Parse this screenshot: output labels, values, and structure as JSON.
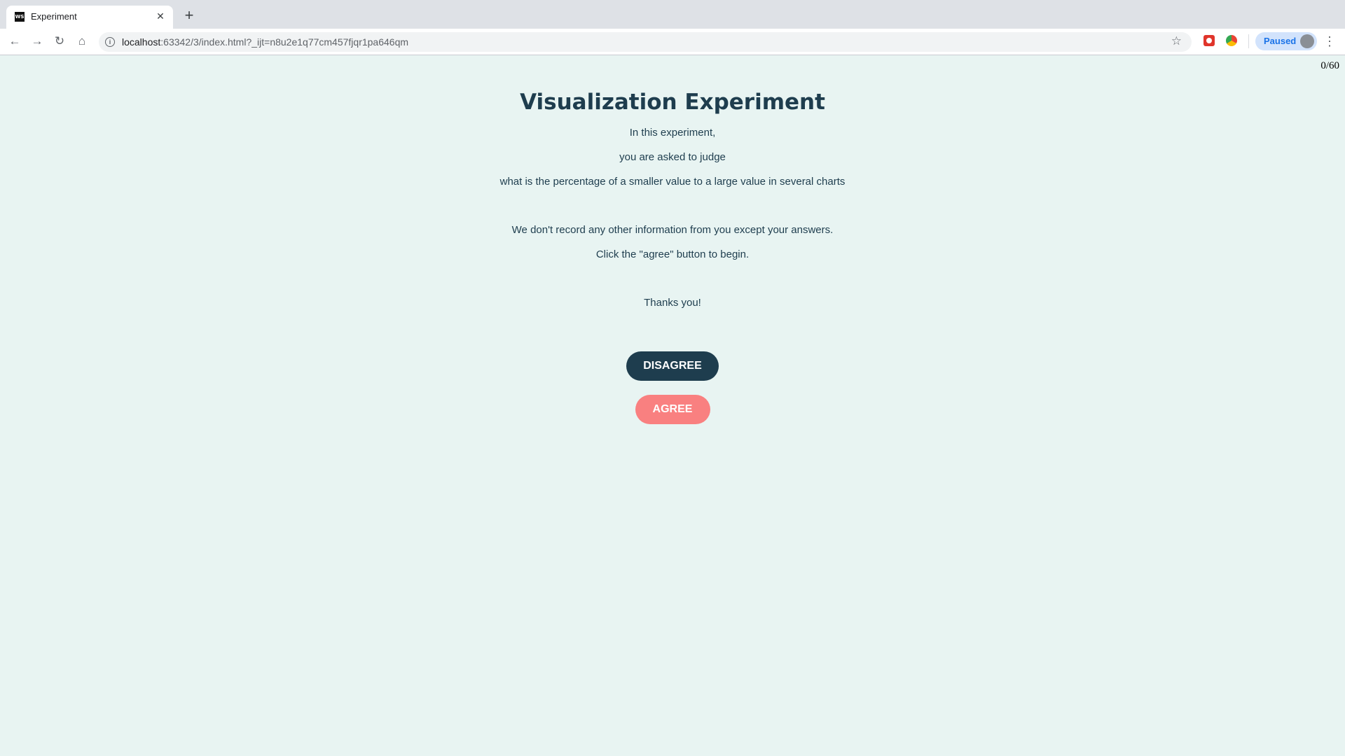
{
  "browser": {
    "tab_title": "Experiment",
    "tab_favicon_text": "WS",
    "url_host": "localhost",
    "url_rest": ":63342/3/index.html?_ijt=n8u2e1q77cm457fjqr1pa646qm",
    "profile_label": "Paused",
    "icons": {
      "back": "arrow-left-icon",
      "forward": "arrow-right-icon",
      "reload": "reload-icon",
      "home": "home-icon",
      "info": "info-icon",
      "bookmark": "star-icon",
      "menu": "kebab-menu-icon"
    },
    "colors": {
      "tabstrip": "#dee1e6",
      "profile_chip": "#d2e3fc",
      "profile_text": "#1a73e8"
    }
  },
  "page": {
    "progress": "0/60",
    "title": "Visualization Experiment",
    "lines": [
      "In this experiment,",
      "you are asked to judge",
      "what is the percentage of a smaller value to a large value in several charts",
      "We don't record any other information from you except your answers.",
      "Click the \"agree\" button to begin.",
      "Thanks you!"
    ],
    "disagree_label": "DISAGREE",
    "agree_label": "AGREE",
    "colors": {
      "background": "#e8f4f2",
      "text": "#1e3d4e",
      "disagree": "#1e3d4e",
      "agree": "#f98080"
    }
  }
}
